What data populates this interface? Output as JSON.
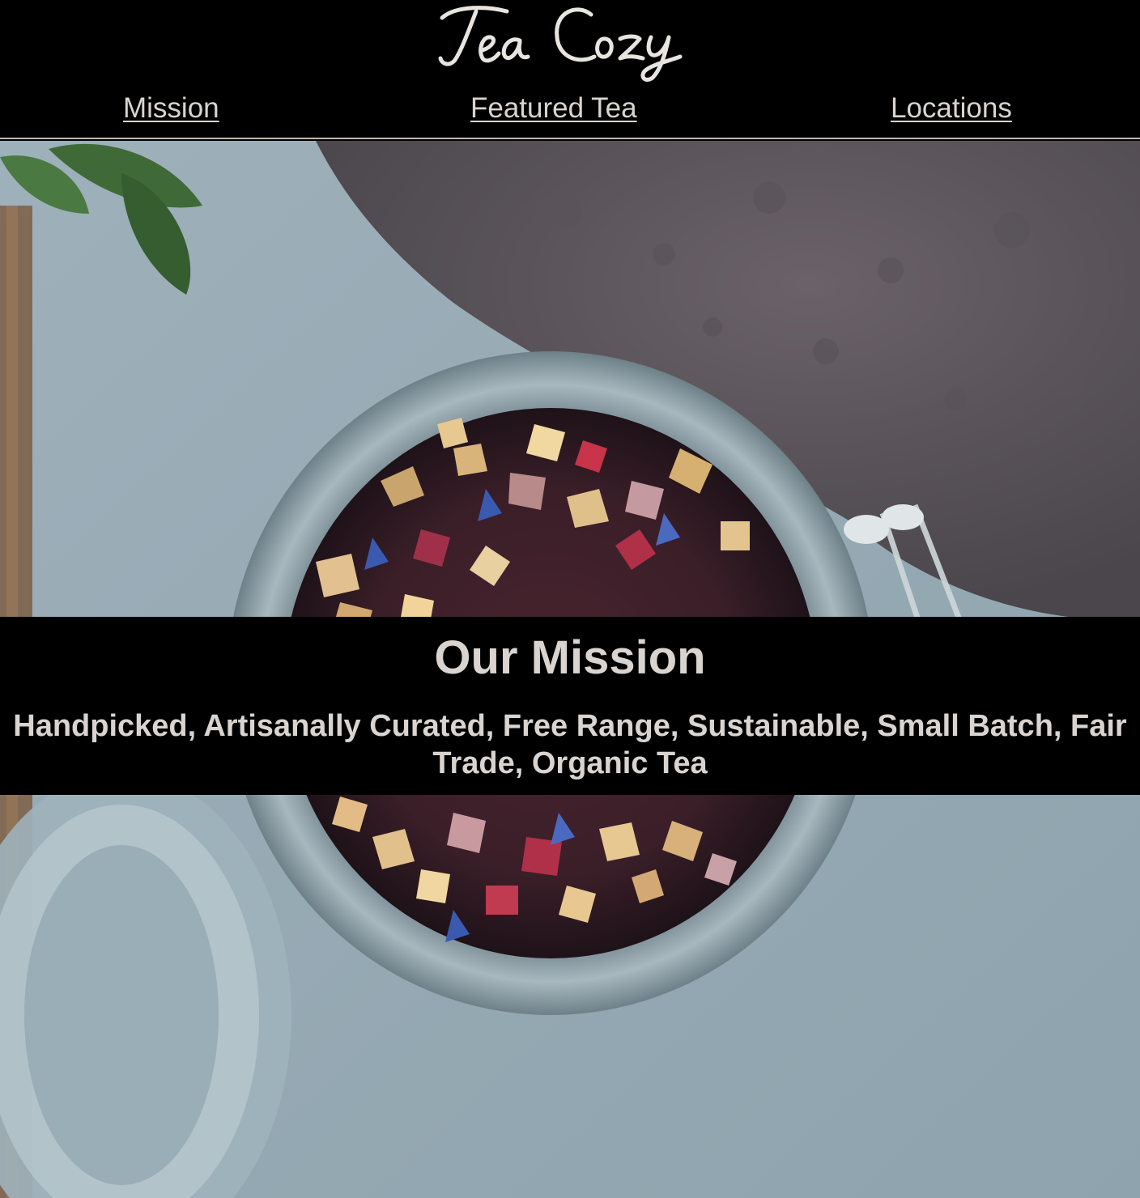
{
  "brand": {
    "logo_text": "Tea Cozy"
  },
  "nav": {
    "items": [
      {
        "label": "Mission"
      },
      {
        "label": "Featured Tea"
      },
      {
        "label": "Locations"
      }
    ]
  },
  "hero": {
    "image": "loose-leaf-tea-jar-photo"
  },
  "mission": {
    "title": "Our Mission",
    "text": "Handpicked, Artisanally Curated, Free Range, Sustainable, Small Batch, Fair Trade, Organic Tea"
  },
  "colors": {
    "header_bg": "#000000",
    "text": "#d9d4d0",
    "band_bg": "#000000"
  }
}
